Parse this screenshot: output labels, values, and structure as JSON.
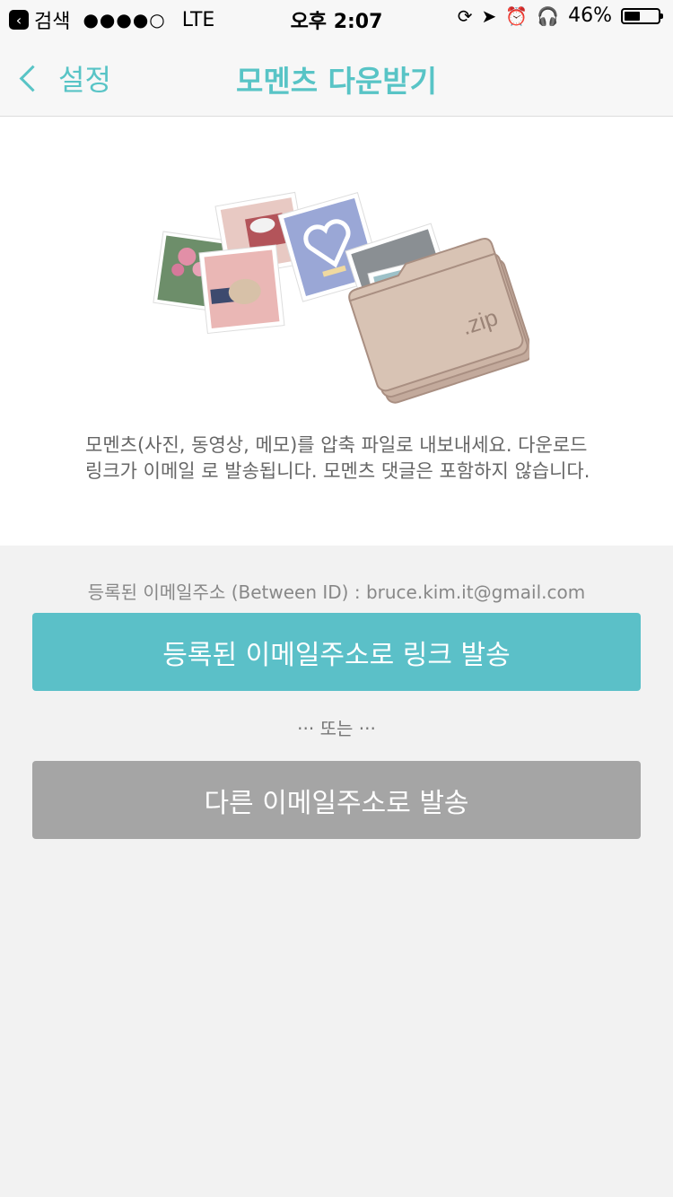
{
  "status": {
    "back_label": "검색",
    "signal": "●●●●○",
    "network": "LTE",
    "time": "오후 2:07",
    "battery": "46%",
    "battery_level": 0.46
  },
  "nav": {
    "back_label": "설정",
    "title": "모멘츠 다운받기"
  },
  "illustration": {
    "zip_label": ".zip"
  },
  "description": "모멘츠(사진, 동영상, 메모)를 압축 파일로 내보내세요. 다운로드 링크가 이메일 로 발송됩니다. 모멘츠 댓글은 포함하지 않습니다.",
  "email": {
    "label": "등록된 이메일주소 (Between ID) :",
    "address": "bruce.kim.it@gmail.com"
  },
  "buttons": {
    "primary": "등록된 이메일주소로 링크 발송",
    "or": "··· 또는 ···",
    "secondary": "다른 이메일주소로 발송"
  },
  "colors": {
    "accent": "#58c4c6",
    "primary_button": "#5bc0c8",
    "secondary_button": "#a5a5a5",
    "background": "#f2f2f2"
  }
}
